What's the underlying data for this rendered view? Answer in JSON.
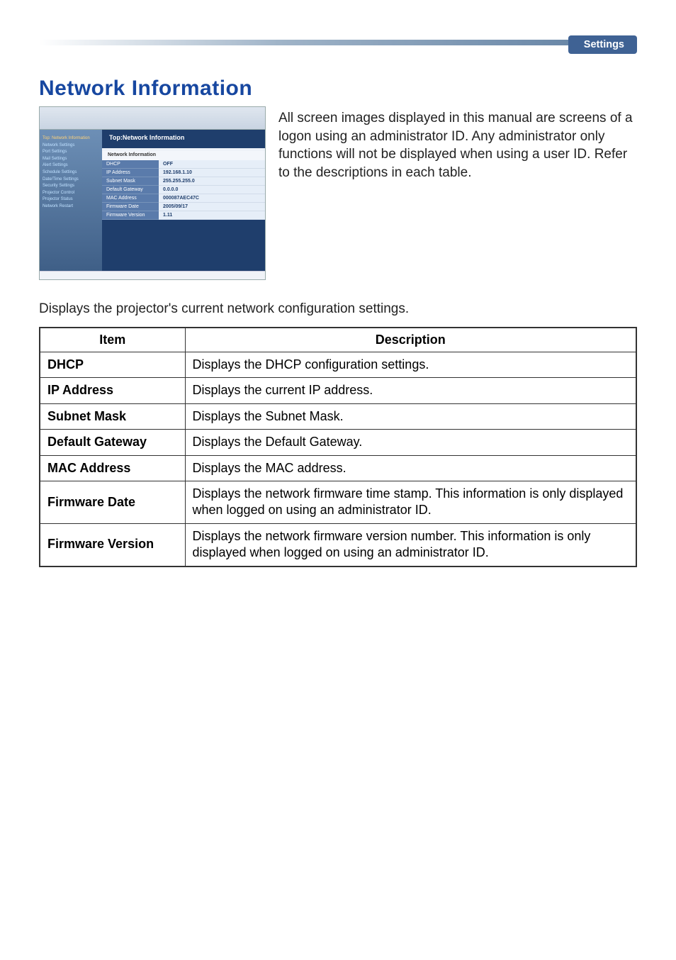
{
  "header": {
    "badge": "Settings"
  },
  "title": "Network Information",
  "intro_paragraph": "All screen images displayed in this manual are screens of a logon using an administrator ID. Any administrator only functions will not be displayed when using a user ID. Refer to the descriptions in each table.",
  "table_intro": "Displays the projector's current network configuration settings.",
  "table": {
    "headers": {
      "item": "Item",
      "description": "Description"
    },
    "rows": [
      {
        "item": "DHCP",
        "description": "Displays the DHCP configuration settings."
      },
      {
        "item": "IP Address",
        "description": "Displays the current IP address."
      },
      {
        "item": "Subnet Mask",
        "description": "Displays the Subnet Mask."
      },
      {
        "item": "Default Gateway",
        "description": "Displays the Default Gateway."
      },
      {
        "item": "MAC Address",
        "description": "Displays the MAC address."
      },
      {
        "item": "Firmware Date",
        "description": "Displays the network firmware time stamp. This information is only displayed when logged on using an administrator ID."
      },
      {
        "item": "Firmware Version",
        "description": "Displays the network firmware version number. This information is only displayed when logged on using an administrator ID."
      }
    ]
  },
  "screenshot": {
    "window_title": "Top:Network Information",
    "card_title": "Network Information",
    "sidebar": {
      "highlight": "Top:\nNetwork\nInformation",
      "items": [
        "Network Settings",
        "Port Settings",
        "Mail Settings",
        "Alert Settings",
        "Schedule Settings",
        "Date/Time Settings",
        "Security Settings",
        "Projector Control",
        "Projector Status",
        "Network Restart"
      ]
    },
    "fields": [
      {
        "label": "DHCP",
        "value": "OFF"
      },
      {
        "label": "IP Address",
        "value": "192.168.1.10"
      },
      {
        "label": "Subnet Mask",
        "value": "255.255.255.0"
      },
      {
        "label": "Default Gateway",
        "value": "0.0.0.0"
      },
      {
        "label": "MAC Address",
        "value": "000087AEC47C"
      },
      {
        "label": "Firmware Date",
        "value": "2005/09/17"
      },
      {
        "label": "Firmware Version",
        "value": "1.11"
      }
    ]
  }
}
